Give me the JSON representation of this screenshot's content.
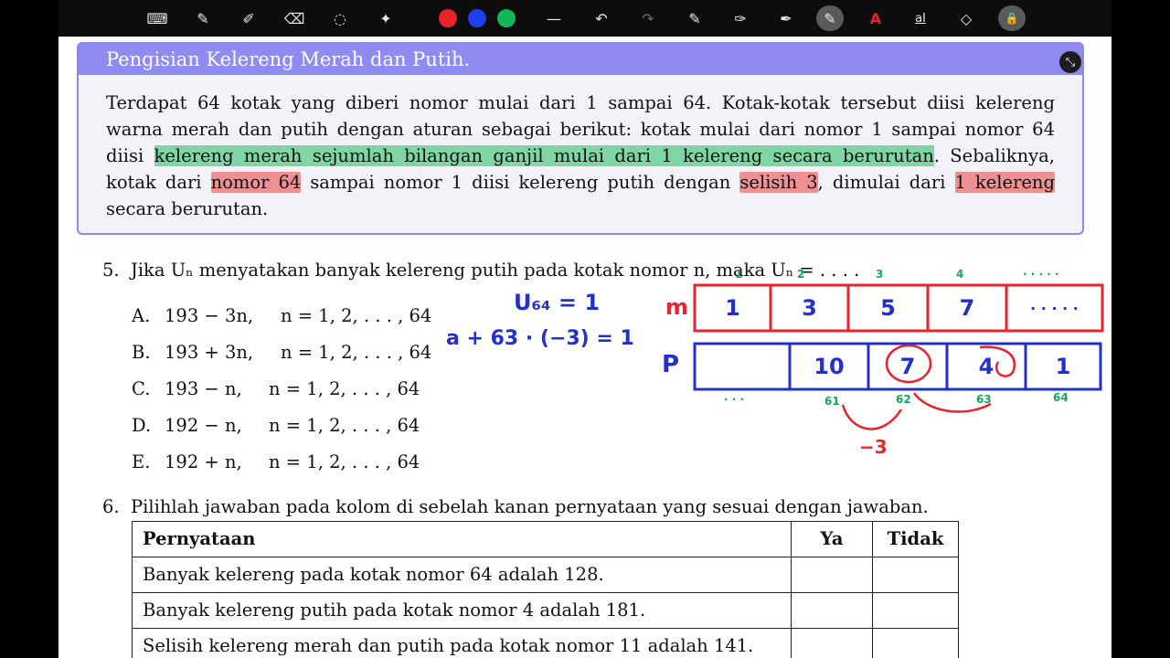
{
  "toolbar": {
    "tools": [
      {
        "icon": "keyboard-icon",
        "glyph": "⌨"
      },
      {
        "icon": "pen-icon",
        "glyph": "✎"
      },
      {
        "icon": "highlighter-icon",
        "glyph": "✐"
      },
      {
        "icon": "eraser-icon",
        "glyph": "⌫"
      },
      {
        "icon": "lasso-icon",
        "glyph": "◌"
      },
      {
        "icon": "magic-pen-icon",
        "glyph": "✦"
      }
    ],
    "colors": [
      "#e8232b",
      "#1f3fe8",
      "#10b85a"
    ],
    "actions": [
      {
        "icon": "line-width-icon",
        "glyph": "—",
        "disabled": false
      },
      {
        "icon": "undo-icon",
        "glyph": "↶",
        "disabled": false
      },
      {
        "icon": "redo-icon",
        "glyph": "↷",
        "disabled": true
      },
      {
        "icon": "shape-pen-icon",
        "glyph": "✎",
        "disabled": false
      },
      {
        "icon": "pen-settings-icon",
        "glyph": "✑",
        "disabled": false
      },
      {
        "icon": "pen-tool-icon",
        "glyph": "✒",
        "disabled": false
      },
      {
        "icon": "active-pen-icon",
        "glyph": "✎",
        "disabled": false,
        "active": true
      },
      {
        "icon": "laser-icon",
        "glyph": "A",
        "disabled": false
      },
      {
        "icon": "text-icon",
        "glyph": "aI",
        "disabled": false
      },
      {
        "icon": "shapes-icon",
        "glyph": "◇",
        "disabled": false
      },
      {
        "icon": "lock-icon",
        "glyph": "🔒",
        "disabled": false,
        "active": true
      }
    ]
  },
  "box": {
    "title": "Pengisian Kelereng Merah dan Putih.",
    "line1": "Terdapat 64 kotak yang diberi nomor mulai dari 1 sampai 64. Kotak-kotak tersebut diisi kelereng",
    "line2": "warna merah dan putih dengan aturan sebagai berikut: kotak mulai dari nomor 1 sampai nomor 64",
    "line3_a": "diisi ",
    "line3_hl": "kelereng merah sejumlah bilangan ganjil mulai dari 1 kelereng secara berurutan",
    "line3_b": ". Sebaliknya,",
    "line4_a": "kotak dari ",
    "line4_hl1": "nomor 64",
    "line4_b": " sampai nomor 1 diisi kelereng putih dengan ",
    "line4_hl2": "selisih 3",
    "line4_c": ", dimulai dari ",
    "line4_hl3": "1 kelereng",
    "line5": "secara berurutan."
  },
  "q5": {
    "number": "5.",
    "text": "Jika Uₙ menyatakan banyak kelereng putih pada kotak nomor n, maka Uₙ = . . . .",
    "options": [
      {
        "label": "A.",
        "expr": "193 − 3n,",
        "range": "n = 1, 2, . . . , 64"
      },
      {
        "label": "B.",
        "expr": "193 + 3n,",
        "range": "n = 1, 2, . . . , 64"
      },
      {
        "label": "C.",
        "expr": "193 − n,",
        "range": "n = 1, 2, . . . , 64"
      },
      {
        "label": "D.",
        "expr": "192 − n,",
        "range": "n = 1, 2, . . . , 64"
      },
      {
        "label": "E.",
        "expr": "192 + n,",
        "range": "n = 1, 2, . . . , 64"
      }
    ]
  },
  "annotations": {
    "u64": "U₆₄ = 1",
    "eq": "a + 63 · (−3) = 1",
    "m_label": "m",
    "p_label": "P",
    "m_cells": [
      "1",
      "3",
      "5",
      "7",
      "· · · · ·"
    ],
    "p_cells": [
      "",
      "10",
      "7",
      "4",
      "1"
    ],
    "top_nums": [
      "1",
      "2",
      "3",
      "4",
      "· · · · ·"
    ],
    "bottom_nums": [
      "· · ·",
      "61",
      "62",
      "63",
      "64"
    ],
    "diff": "−3"
  },
  "q6": {
    "number": "6.",
    "text": "Pilihlah jawaban pada kolom di sebelah kanan pernyataan yang sesuai dengan jawaban.",
    "headers": [
      "Pernyataan",
      "Ya",
      "Tidak"
    ],
    "rows": [
      "Banyak kelereng pada kotak nomor 64 adalah 128.",
      "Banyak kelereng putih pada kotak nomor 4 adalah 181.",
      "Selisih kelereng merah dan putih pada kotak nomor 11 adalah 141."
    ]
  }
}
